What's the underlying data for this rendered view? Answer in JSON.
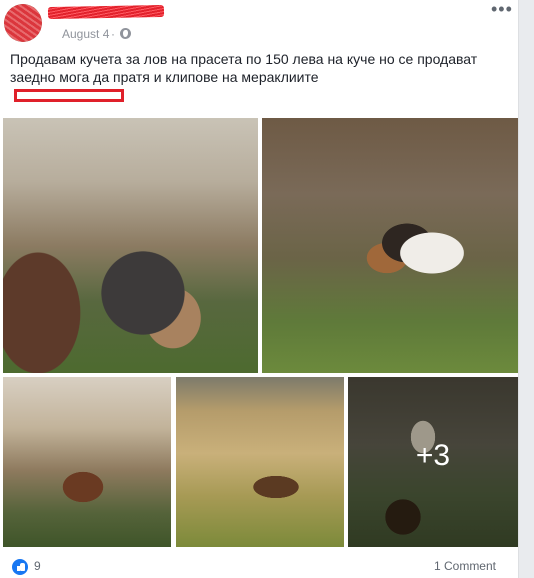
{
  "post": {
    "author_redacted": true,
    "date": "August 4",
    "separator": "·",
    "privacy_icon": "globe-icon",
    "menu_label": "•••",
    "text_lines": [
      "Продавам кучета за лов на прасета по 150 лева на куче но се продават",
      "заедно мога да пратя и клипове на мераклиите"
    ]
  },
  "photos": {
    "more_label": "+3"
  },
  "footer": {
    "likes_count": "9",
    "comments_label": "1 Comment"
  },
  "colors": {
    "accent": "#1877f2",
    "redaction": "#e0202a"
  }
}
